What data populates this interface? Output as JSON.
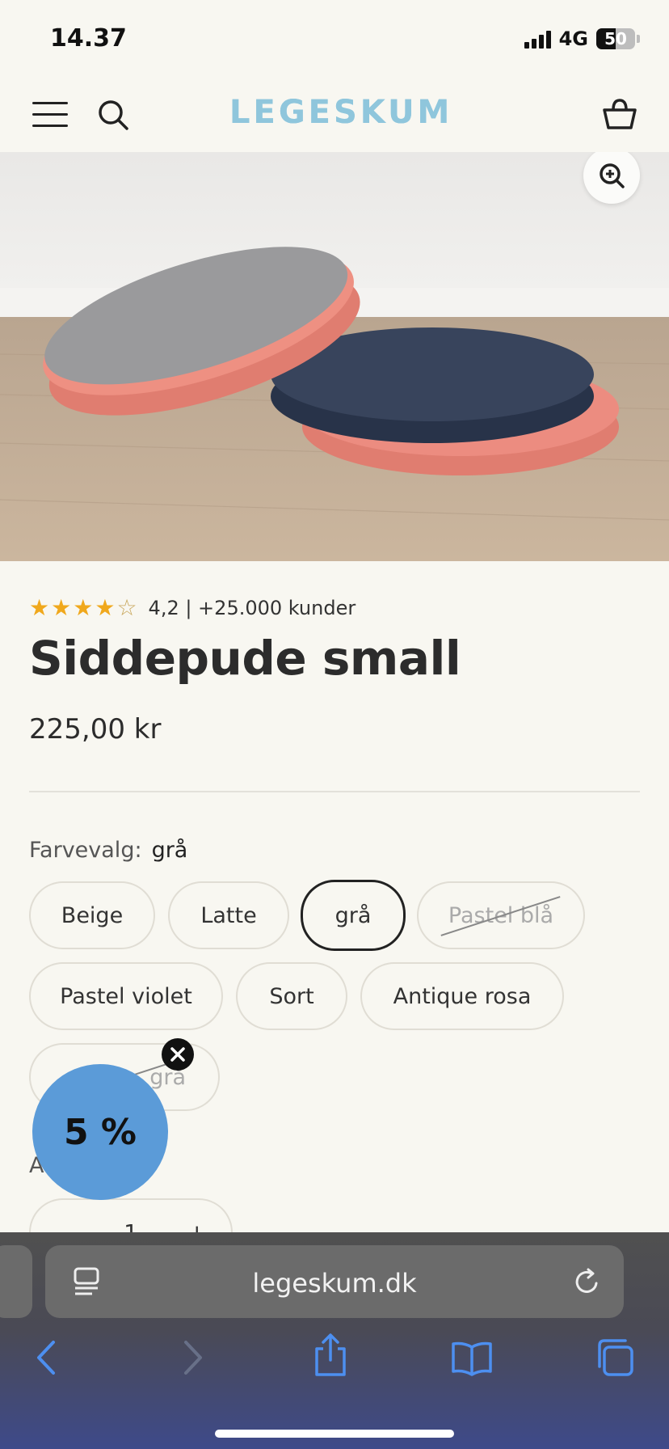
{
  "status_bar": {
    "time": "14.37",
    "network": "4G",
    "battery_level": "50",
    "battery_fraction": 0.5
  },
  "header": {
    "logo_text": "LEGESKUM",
    "logo_color": "#8fc6dc"
  },
  "product": {
    "image_alt": "",
    "rating_stars": 4.2,
    "rating_text": "4,2 | +25.000 kunder",
    "title": "Siddepude small",
    "price": "225,00 kr"
  },
  "color_option": {
    "label": "Farvevalg:",
    "selected_value": "grå",
    "options": [
      {
        "label": "Beige",
        "state": "normal"
      },
      {
        "label": "Latte",
        "state": "normal"
      },
      {
        "label": "grå",
        "state": "selected"
      },
      {
        "label": "Pastel blå",
        "state": "disabled"
      },
      {
        "label": "Pastel violet",
        "state": "normal"
      },
      {
        "label": "Sort",
        "state": "normal"
      },
      {
        "label": "Antique rosa",
        "state": "normal"
      },
      {
        "label": "Lysegrå/mørkegrå",
        "state": "disabled",
        "visible_text": "... grå"
      }
    ]
  },
  "quantity": {
    "label_partial": "A",
    "minus": "−",
    "value": "1",
    "plus": "+"
  },
  "discount_popup": {
    "text": "5 %",
    "color": "#5b9bd8"
  },
  "browser": {
    "url": "legeskum.dk"
  }
}
